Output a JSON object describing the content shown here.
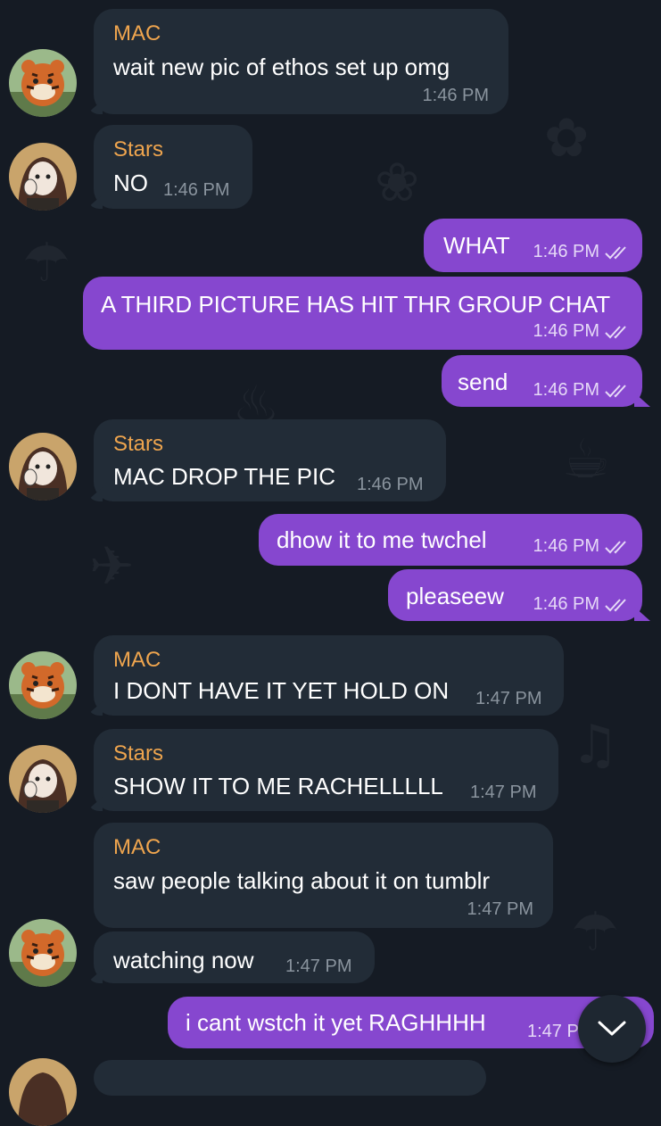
{
  "chat": {
    "scroll_down_icon": "chevron-down-icon",
    "colors": {
      "background": "#151b24",
      "incoming_bubble": "#222c37",
      "outgoing_bubble": "#8647cf",
      "sender_name": "#efa54e"
    },
    "messages": [
      {
        "sender": "MAC",
        "text": "wait new pic of ethos set up omg",
        "time": "1:46 PM"
      },
      {
        "sender": "Stars",
        "text": "NO",
        "time": "1:46 PM"
      },
      {
        "text": "WHAT",
        "time": "1:46 PM",
        "status": "read"
      },
      {
        "text": "A THIRD PICTURE HAS HIT THR GROUP CHAT",
        "time": "1:46 PM",
        "status": "read"
      },
      {
        "text": "send",
        "time": "1:46 PM",
        "status": "read"
      },
      {
        "sender": "Stars",
        "text": "MAC DROP THE PIC",
        "time": "1:46 PM"
      },
      {
        "text": "dhow it to me twchel",
        "time": "1:46 PM",
        "status": "read"
      },
      {
        "text": "pleaseew",
        "time": "1:46 PM",
        "status": "read"
      },
      {
        "sender": "MAC",
        "text": "I DONT HAVE IT YET HOLD ON",
        "time": "1:47 PM"
      },
      {
        "sender": "Stars",
        "text": "SHOW IT TO ME RACHELLLLL",
        "time": "1:47 PM"
      },
      {
        "sender": "MAC",
        "text": "saw people talking about it on tumblr",
        "time": "1:47 PM"
      },
      {
        "text": "watching now",
        "time": "1:47 PM"
      },
      {
        "text": "i cant wstch it yet RAGHHHH",
        "time": "1:47 P"
      }
    ]
  }
}
